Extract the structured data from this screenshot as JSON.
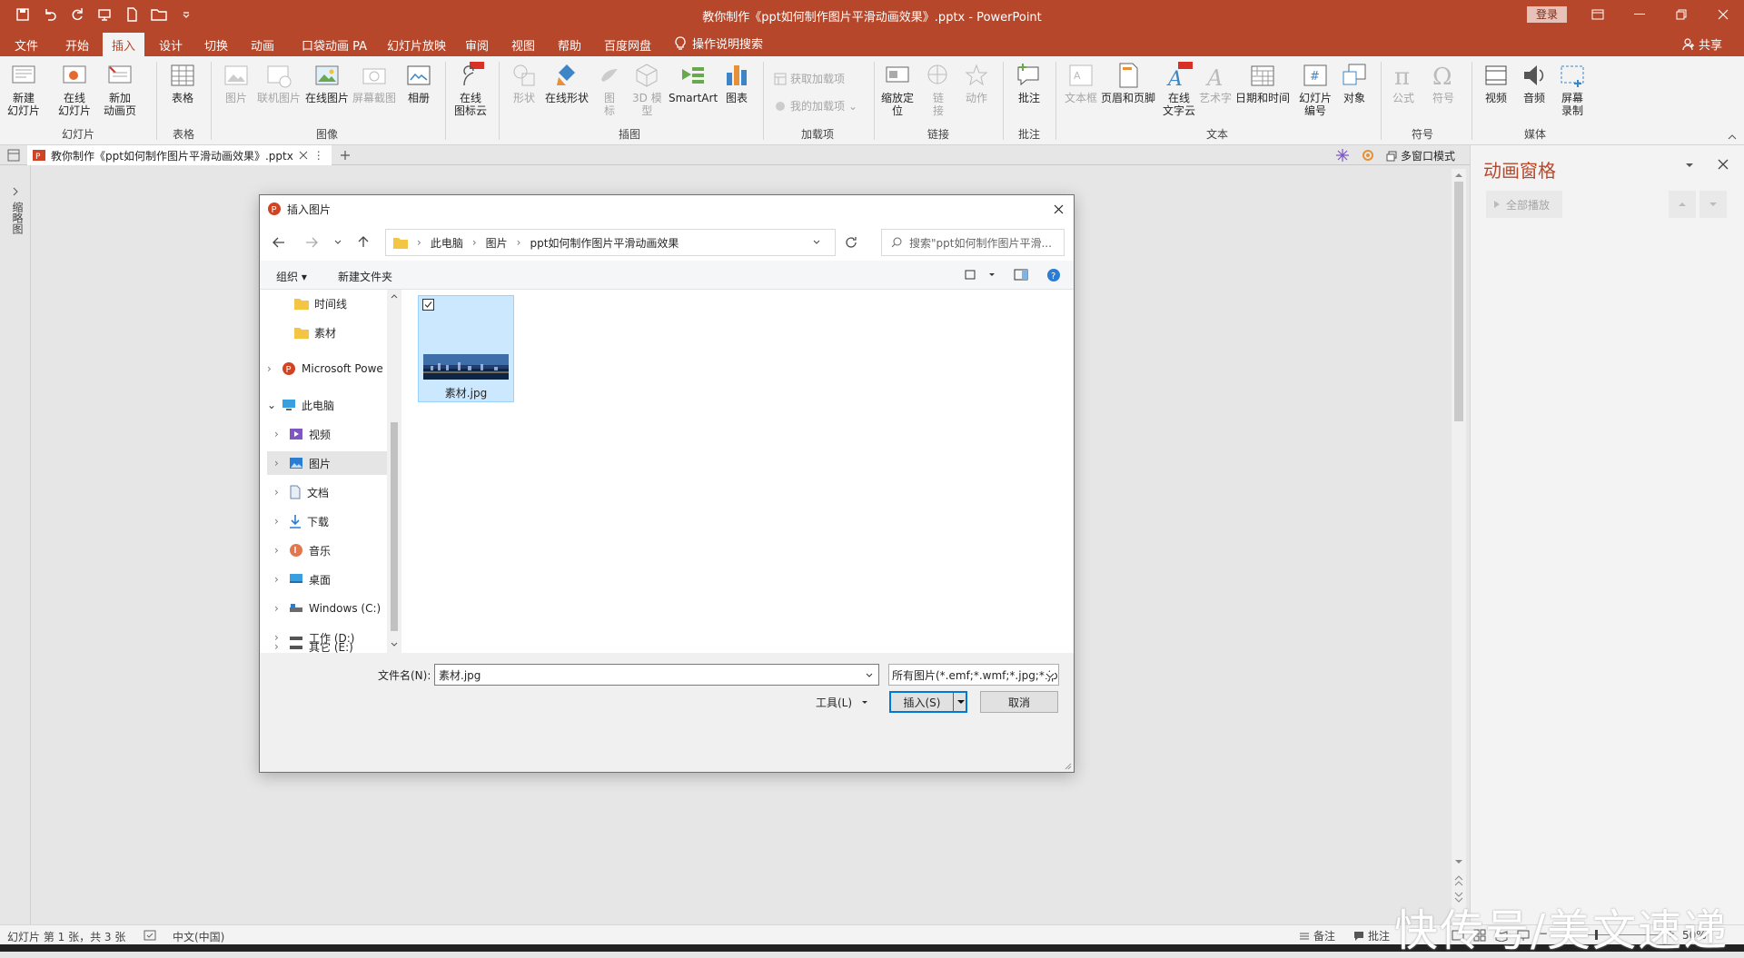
{
  "app": {
    "doc_title": "教你制作《ppt如何制作图片平滑动画效果》.pptx - PowerPoint",
    "login_label": "登录",
    "share_label": "共享",
    "tell_me_label": "操作说明搜索"
  },
  "tabs": [
    {
      "label": "文件"
    },
    {
      "label": "开始"
    },
    {
      "label": "插入"
    },
    {
      "label": "设计"
    },
    {
      "label": "切换"
    },
    {
      "label": "动画"
    },
    {
      "label": "口袋动画 PA"
    },
    {
      "label": "幻灯片放映"
    },
    {
      "label": "审阅"
    },
    {
      "label": "视图"
    },
    {
      "label": "帮助"
    },
    {
      "label": "百度网盘"
    }
  ],
  "ribbon": {
    "groups": [
      "幻灯片",
      "表格",
      "图像",
      "在线图标云",
      "插图",
      "加载项",
      "链接",
      "批注",
      "文本",
      "符号",
      "媒体"
    ],
    "buttons": {
      "new_slide": "新建\n幻灯片",
      "online_slide": "在线\n幻灯片",
      "new_anim_page": "新加\n动画页",
      "table": "表格",
      "picture": "图片",
      "online_picture_linked": "联机图片",
      "online_picture": "在线图片",
      "screenshot": "屏幕截图",
      "album": "相册",
      "online_icon_cloud": "在线\n图标云",
      "shapes": "形状",
      "online_shapes": "在线形状",
      "icons": "图\n标",
      "model_3d": "3D 模\n型",
      "smartart": "SmartArt",
      "chart": "图表",
      "get_addins": "获取加载项",
      "my_addins": "我的加载项",
      "zoom": "缩放定\n位",
      "link": "链\n接",
      "action": "动作",
      "comment": "批注",
      "textbox": "文本框",
      "header_footer": "页眉和页脚",
      "online_wordcloud": "在线\n文字云",
      "wordart": "艺术字",
      "datetime": "日期和时间",
      "slide_number": "幻灯片\n编号",
      "object": "对象",
      "equation": "公式",
      "symbol": "符号",
      "video": "视频",
      "audio": "音频",
      "screen_record": "屏幕\n录制",
      "hot_badge": "HOT"
    }
  },
  "doc_tab": {
    "label": "教你制作《ppt如何制作图片平滑动画效果》.pptx"
  },
  "multiwindow_label": "多窗口模式",
  "left_strip_label": "缩略图",
  "anim_pane": {
    "title": "动画窗格",
    "play_all": "全部播放"
  },
  "dialog": {
    "title": "插入图片",
    "breadcrumb": [
      "此电脑",
      "图片",
      "ppt如何制作图片平滑动画效果"
    ],
    "search_placeholder": "搜索\"ppt如何制作图片平滑...",
    "organize": "组织",
    "new_folder": "新建文件夹",
    "tree": [
      "时间线",
      "素材",
      "Microsoft Powe",
      "此电脑",
      "视频",
      "图片",
      "文档",
      "下载",
      "音乐",
      "桌面",
      "Windows (C:)",
      "工作 (D:)",
      "其它 (E:)"
    ],
    "file_name": "素材.jpg",
    "filename_label": "文件名(N):",
    "filename_value": "素材.jpg",
    "filetype_value": "所有图片(*.emf;*.wmf;*.jpg;*.jp",
    "tools_label": "工具(L)",
    "insert_label": "插入(S)",
    "cancel_label": "取消"
  },
  "status": {
    "slide_info": "幻灯片 第 1 张，共 3 张",
    "language": "中文(中国)",
    "notes": "备注",
    "comments": "批注",
    "zoom": "50%"
  },
  "watermark": "快传号/美文速递",
  "colors": {
    "accent": "#b7472a",
    "select": "#cce8ff",
    "focus": "#0078d7"
  }
}
